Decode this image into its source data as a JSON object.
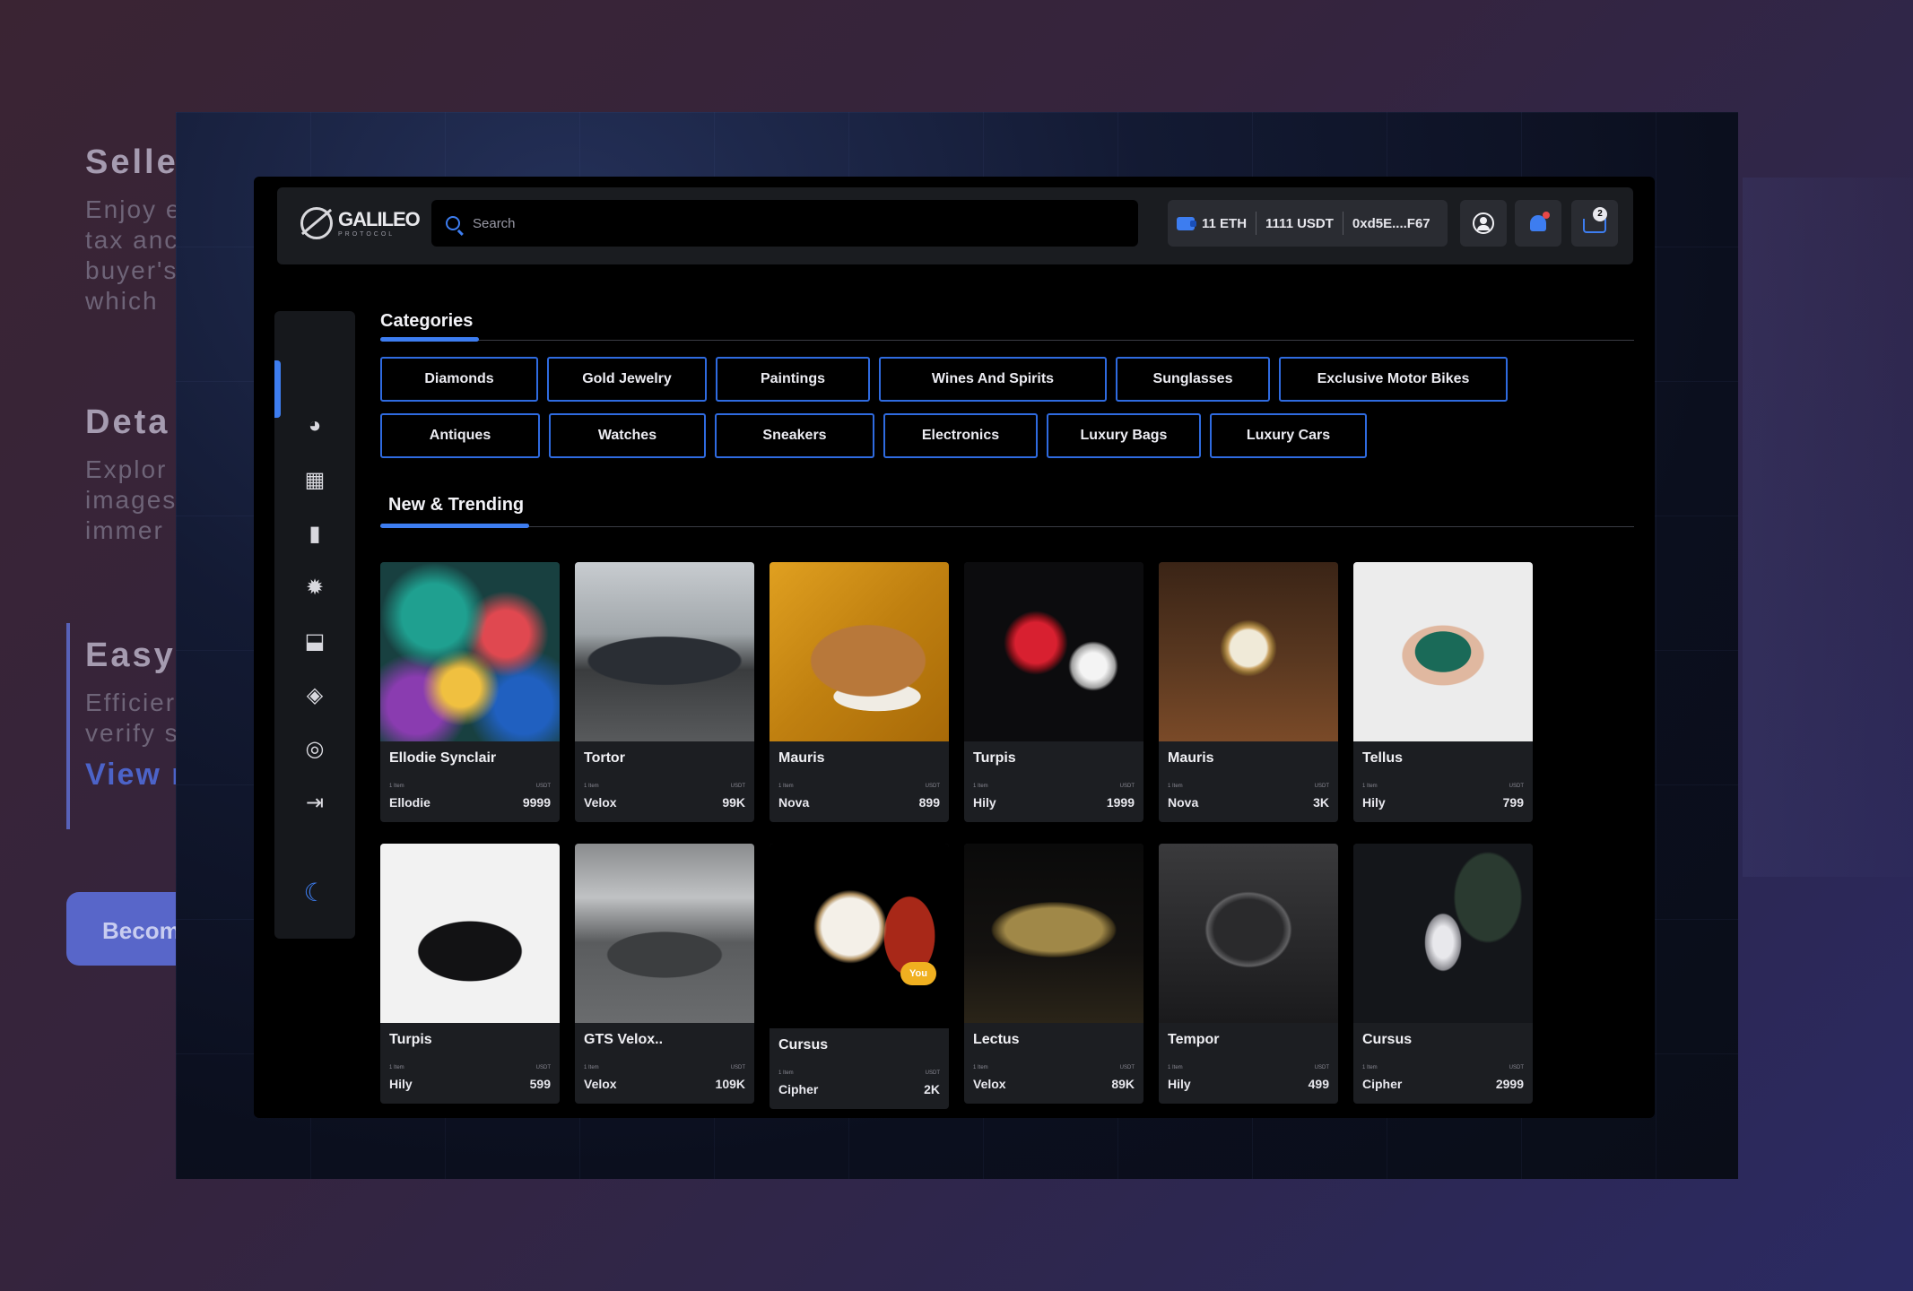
{
  "background": {
    "sections": [
      {
        "heading": "Selle",
        "text": "Enjoy e tax anc buyer's which"
      },
      {
        "heading": "Deta",
        "text": "Explor images immer"
      },
      {
        "heading": "Easy",
        "text": "Efficier verify s",
        "link": "View r"
      }
    ],
    "button_label": "Becom"
  },
  "header": {
    "logo_name": "GALILEO",
    "logo_sub": "PROTOCOL",
    "search_placeholder": "Search",
    "wallet": {
      "eth": "11 ETH",
      "usdt": "1111 USDT",
      "address": "0xd5E....F67"
    },
    "cart_count": "2"
  },
  "sidebar": {
    "items": [
      "chart-pie-icon",
      "store-icon",
      "bookmark-icon",
      "gear-icon",
      "download-tray-icon",
      "tag-icon",
      "support-icon",
      "logout-icon"
    ],
    "theme_toggle": "moon-icon"
  },
  "categories": {
    "title": "Categories",
    "row1": [
      "Diamonds",
      "Gold Jewelry",
      "Paintings",
      "Wines And Spirits",
      "Sunglasses",
      "Exclusive Motor Bikes"
    ],
    "row2": [
      "Antiques",
      "Watches",
      "Sneakers",
      "Electronics",
      "Luxury Bags",
      "Luxury Cars"
    ]
  },
  "trending": {
    "title": "New & Trending",
    "item_label": "1 Item",
    "currency": "USDT",
    "you_badge": "You",
    "cards": [
      {
        "title": "Ellodie Synclair",
        "seller": "Ellodie",
        "price": "9999"
      },
      {
        "title": "Tortor",
        "seller": "Velox",
        "price": "99K"
      },
      {
        "title": "Mauris",
        "seller": "Nova",
        "price": "899"
      },
      {
        "title": "Turpis",
        "seller": "Hily",
        "price": "1999"
      },
      {
        "title": "Mauris",
        "seller": "Nova",
        "price": "3K"
      },
      {
        "title": "Tellus",
        "seller": "Hily",
        "price": "799"
      },
      {
        "title": "Turpis",
        "seller": "Hily",
        "price": "599"
      },
      {
        "title": "GTS Velox..",
        "seller": "Velox",
        "price": "109K"
      },
      {
        "title": "Cursus",
        "seller": "Cipher",
        "price": "2K"
      },
      {
        "title": "Lectus",
        "seller": "Velox",
        "price": "89K"
      },
      {
        "title": "Tempor",
        "seller": "Hily",
        "price": "499"
      },
      {
        "title": "Cursus",
        "seller": "Cipher",
        "price": "2999"
      }
    ]
  },
  "colors": {
    "accent": "#3d7df0",
    "app_bg": "#000000",
    "card_bg": "#1c1e22",
    "header_bg": "#1a1c20"
  }
}
